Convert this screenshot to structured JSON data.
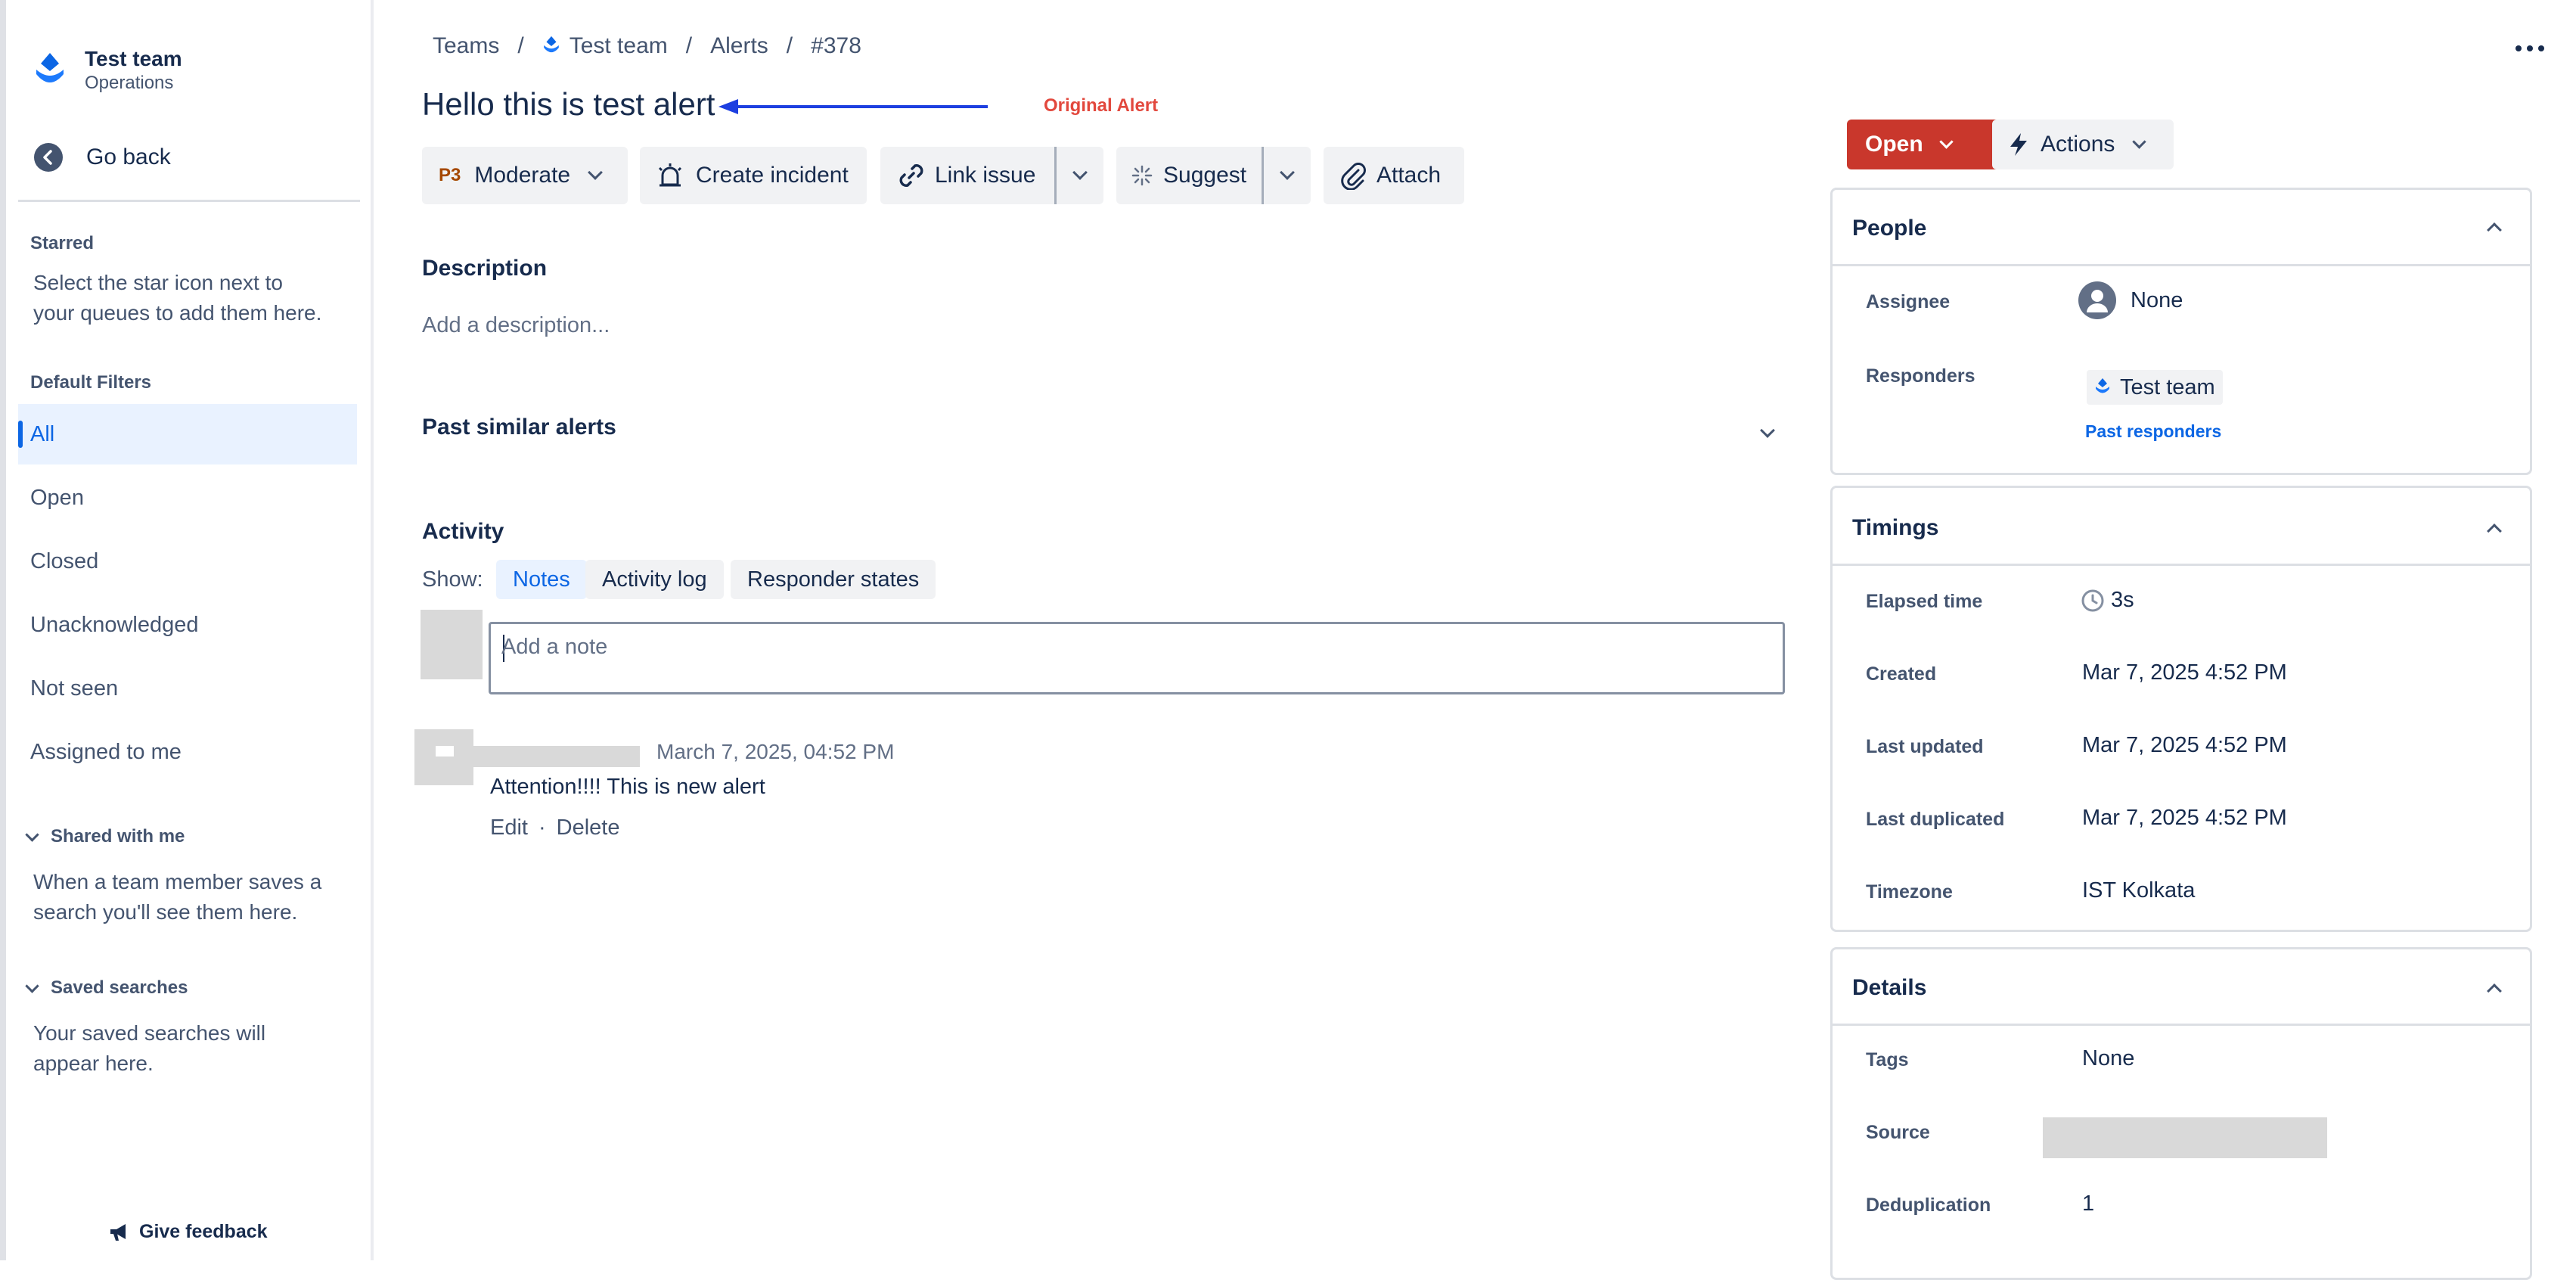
{
  "sidebar": {
    "team_name": "Test team",
    "team_subtitle": "Operations",
    "go_back": "Go back",
    "starred_heading": "Starred",
    "starred_text_1": "Select the star icon next to",
    "starred_text_2": "your queues to add them here.",
    "default_filters_heading": "Default Filters",
    "filters": [
      "All",
      "Open",
      "Closed",
      "Unacknowledged",
      "Not seen",
      "Assigned to me"
    ],
    "shared_heading": "Shared with me",
    "shared_text_1": "When a team member saves a",
    "shared_text_2": "search you'll see them here.",
    "saved_heading": "Saved searches",
    "saved_text_1": "Your saved searches will",
    "saved_text_2": "appear here.",
    "feedback": "Give feedback"
  },
  "breadcrumb": {
    "teams": "Teams",
    "team": "Test team",
    "alerts": "Alerts",
    "id": "#378",
    "sep": "/"
  },
  "alert": {
    "title": "Hello this is test alert",
    "annotation": "Original Alert"
  },
  "toolbar": {
    "priority_code": "P3",
    "priority_label": "Moderate",
    "create_incident": "Create incident",
    "link_issue": "Link issue",
    "suggest": "Suggest",
    "attach": "Attach"
  },
  "description": {
    "heading": "Description",
    "placeholder": "Add a description..."
  },
  "past_similar": {
    "heading": "Past similar alerts"
  },
  "activity": {
    "heading": "Activity",
    "show_label": "Show:",
    "tabs": [
      "Notes",
      "Activity log",
      "Responder states"
    ],
    "note_placeholder": "Add a note",
    "note": {
      "timestamp": "March 7, 2025, 04:52 PM",
      "text": "Attention!!!! This is new alert",
      "edit": "Edit",
      "separator": "·",
      "delete": "Delete"
    }
  },
  "status": {
    "open": "Open",
    "actions": "Actions"
  },
  "people": {
    "title": "People",
    "assignee_label": "Assignee",
    "assignee_value": "None",
    "responders_label": "Responders",
    "responder": "Test team",
    "past_responders": "Past responders"
  },
  "timings": {
    "title": "Timings",
    "rows": [
      {
        "label": "Elapsed time",
        "value": "3s"
      },
      {
        "label": "Created",
        "value": "Mar 7, 2025 4:52 PM"
      },
      {
        "label": "Last updated",
        "value": "Mar 7, 2025 4:52 PM"
      },
      {
        "label": "Last duplicated",
        "value": "Mar 7, 2025 4:52 PM"
      },
      {
        "label": "Timezone",
        "value": "IST Kolkata"
      }
    ]
  },
  "details": {
    "title": "Details",
    "tags_label": "Tags",
    "tags_value": "None",
    "source_label": "Source",
    "dedup_label": "Deduplication",
    "dedup_value": "1"
  },
  "colors": {
    "accent": "#0c66e4",
    "danger": "#c9372c",
    "annotation": "#e2483d",
    "arrow": "#1d3fe0"
  }
}
